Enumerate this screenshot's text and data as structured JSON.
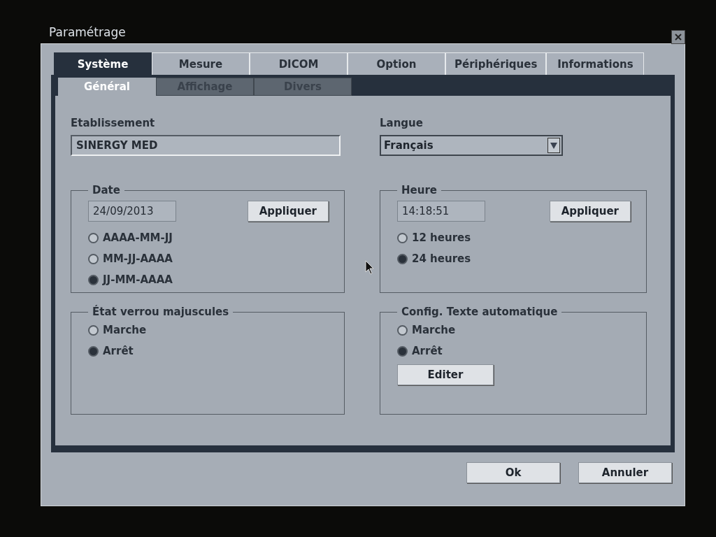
{
  "window": {
    "title": "Paramétrage"
  },
  "tabs": [
    {
      "label": "Système",
      "selected": true
    },
    {
      "label": "Mesure",
      "selected": false
    },
    {
      "label": "DICOM",
      "selected": false
    },
    {
      "label": "Option",
      "selected": false
    },
    {
      "label": "Périphériques",
      "selected": false
    },
    {
      "label": "Informations",
      "selected": false
    }
  ],
  "subtabs": [
    {
      "label": "Général",
      "selected": true
    },
    {
      "label": "Affichage",
      "selected": false
    },
    {
      "label": "Divers",
      "selected": false
    }
  ],
  "establishment": {
    "label": "Etablissement",
    "value": "SINERGY MED"
  },
  "language": {
    "label": "Langue",
    "value": "Français"
  },
  "groups": [
    {
      "kind": "field-group",
      "title": "Date",
      "field": "24/09/2013",
      "button": "Appliquer",
      "options": [
        {
          "label": "AAAA-MM-JJ",
          "selected": false
        },
        {
          "label": "MM-JJ-AAAA",
          "selected": false
        },
        {
          "label": "JJ-MM-AAAA",
          "selected": true
        }
      ]
    },
    {
      "kind": "field-group",
      "title": "Heure",
      "field": "14:18:51",
      "button": "Appliquer",
      "options": [
        {
          "label": "12 heures",
          "selected": false
        },
        {
          "label": "24 heures",
          "selected": true
        }
      ]
    },
    {
      "kind": "option-group",
      "title": "État verrou majuscules",
      "options": [
        {
          "label": "Marche",
          "selected": false
        },
        {
          "label": "Arrêt",
          "selected": true
        }
      ]
    },
    {
      "kind": "option-group",
      "title": "Config. Texte automatique",
      "button": "Editer",
      "options": [
        {
          "label": "Marche",
          "selected": false
        },
        {
          "label": "Arrêt",
          "selected": true
        }
      ]
    }
  ],
  "buttons": [
    "Ok",
    "Annuler"
  ]
}
